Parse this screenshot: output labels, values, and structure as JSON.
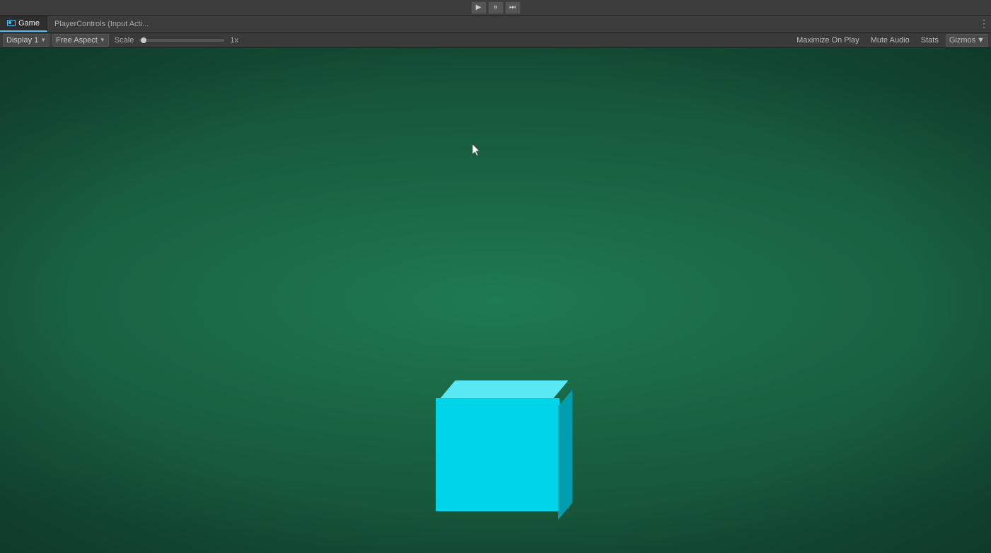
{
  "topbar": {
    "play_label": "▶",
    "pause_label": "⏸",
    "step_label": "⏭"
  },
  "tabs": {
    "game_tab": "Game",
    "game_tab_icon": "game-icon",
    "script_tab": "PlayerControls (Input Acti...",
    "more_icon": "⋮"
  },
  "options": {
    "display_label": "Display 1",
    "display_arrow": "▼",
    "aspect_label": "Free Aspect",
    "aspect_arrow": "▼",
    "scale_label": "Scale",
    "scale_value": "1x",
    "maximize_label": "Maximize On Play",
    "mute_label": "Mute Audio",
    "stats_label": "Stats",
    "gizmos_label": "Gizmos",
    "gizmos_arrow": "▼"
  },
  "viewport": {
    "bg_color": "#1d6b47",
    "cube_color_front": "#00d4e8",
    "cube_color_top": "#5ae8f5",
    "cube_color_right": "#009db0"
  }
}
